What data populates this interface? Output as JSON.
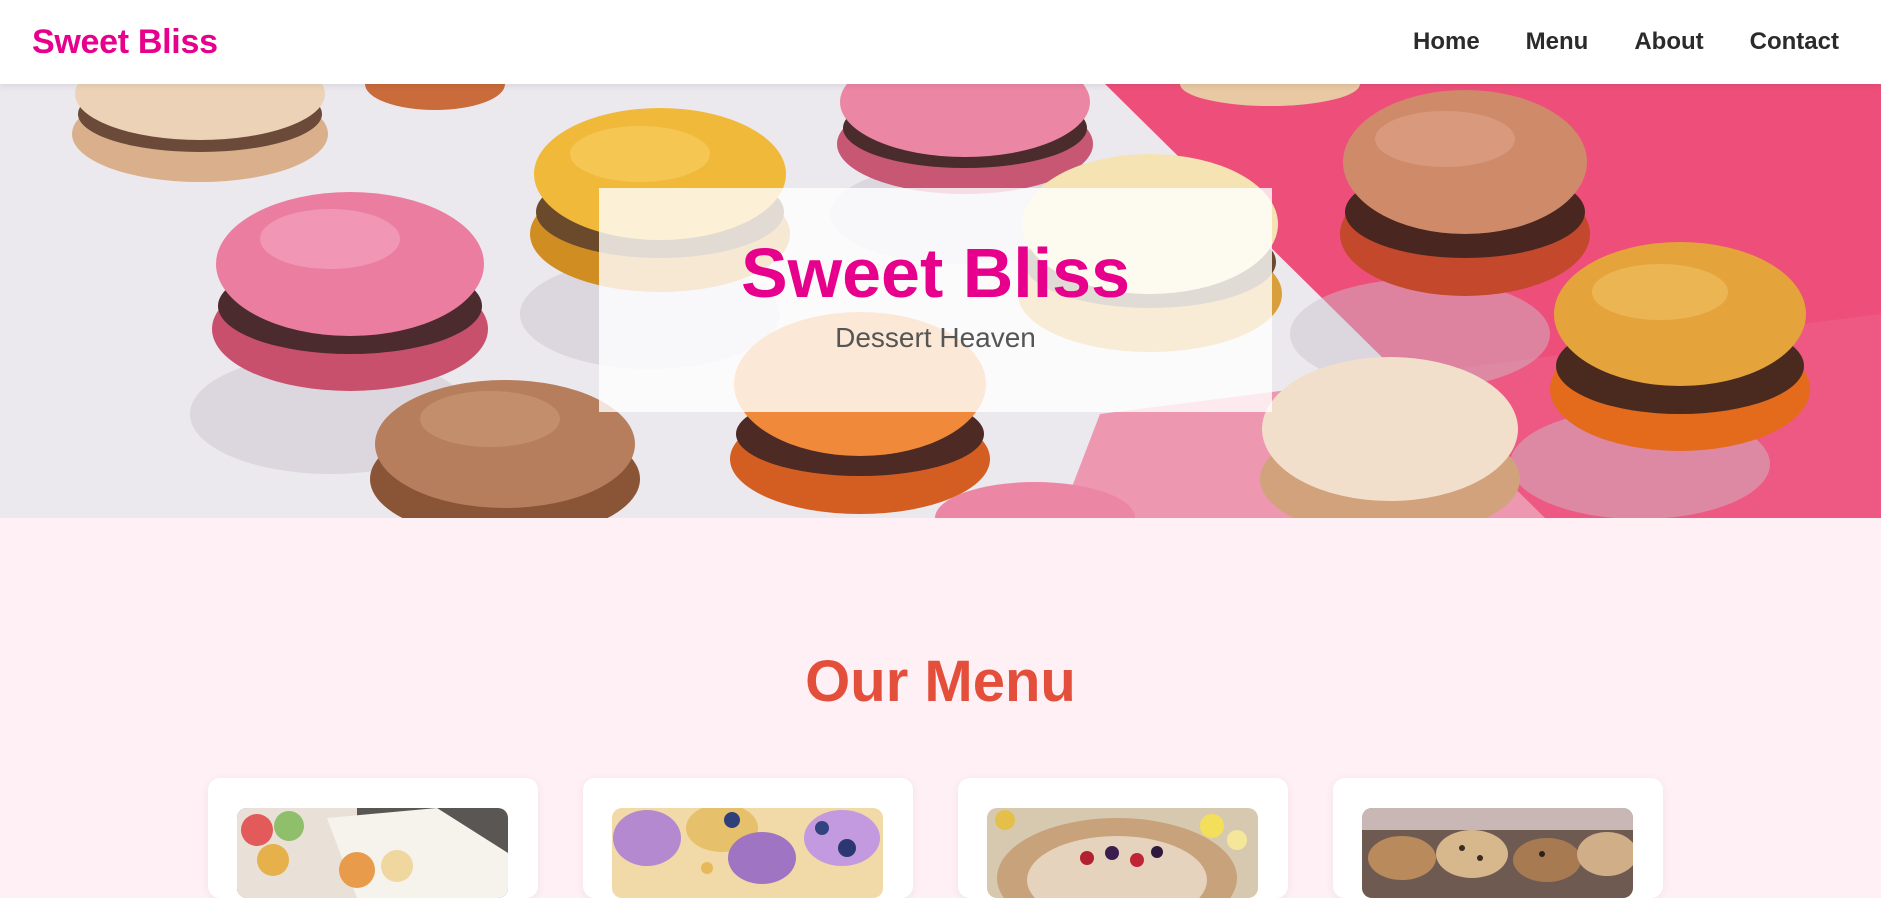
{
  "header": {
    "logo": "Sweet Bliss",
    "nav": [
      "Home",
      "Menu",
      "About",
      "Contact"
    ]
  },
  "hero": {
    "title": "Sweet Bliss",
    "subtitle": "Dessert Heaven"
  },
  "menu": {
    "title": "Our Menu",
    "cards": [
      {
        "image": "macarons-box-photo"
      },
      {
        "image": "cupcakes-photo"
      },
      {
        "image": "tart-photo"
      },
      {
        "image": "pastries-photo"
      }
    ]
  },
  "colors": {
    "brand_pink": "#e6008c",
    "menu_title": "#e34f3a",
    "section_bg": "#fff0f5"
  }
}
